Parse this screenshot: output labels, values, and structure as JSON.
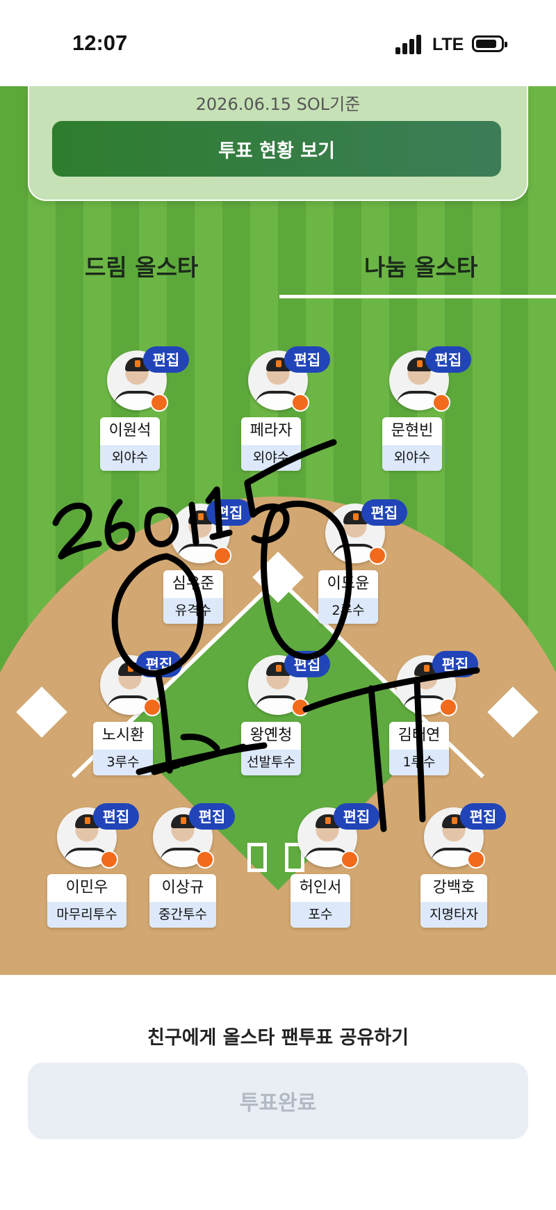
{
  "status_bar": {
    "time": "12:07",
    "network": "LTE"
  },
  "summary_card": {
    "date_text": "2026.06.15 SOL기준",
    "vote_status_button": "투표 현황 보기"
  },
  "tabs": [
    {
      "label": "드림 올스타",
      "selected": false
    },
    {
      "label": "나눔 올스타",
      "selected": true
    }
  ],
  "edit_label": "편집",
  "players": [
    {
      "name": "이원석",
      "position": "외야수"
    },
    {
      "name": "페라자",
      "position": "외야수"
    },
    {
      "name": "문현빈",
      "position": "외야수"
    },
    {
      "name": "심우준",
      "position": "유격수"
    },
    {
      "name": "이도윤",
      "position": "2루수"
    },
    {
      "name": "노시환",
      "position": "3루수"
    },
    {
      "name": "왕옌청",
      "position": "선발투수"
    },
    {
      "name": "김태연",
      "position": "1루수"
    },
    {
      "name": "이민우",
      "position": "마무리투수"
    },
    {
      "name": "이상규",
      "position": "중간투수"
    },
    {
      "name": "허인서",
      "position": "포수"
    },
    {
      "name": "강백호",
      "position": "지명타자"
    }
  ],
  "share_text": "친구에게 올스타 팬투표 공유하기",
  "vote_complete_button": "투표완료",
  "colors": {
    "brand_green": "#2e7d2e",
    "edit_badge_blue": "#2145b8",
    "position_bg": "#dde9fb"
  }
}
